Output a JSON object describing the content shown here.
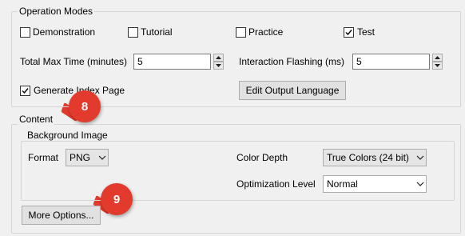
{
  "operation_modes": {
    "title": "Operation Modes",
    "checkboxes": [
      {
        "label": "Demonstration",
        "checked": false
      },
      {
        "label": "Tutorial",
        "checked": false
      },
      {
        "label": "Practice",
        "checked": false
      },
      {
        "label": "Test",
        "checked": true
      }
    ],
    "total_max_time": {
      "label": "Total Max Time (minutes)",
      "value": "5"
    },
    "interaction_flashing": {
      "label": "Interaction Flashing (ms)",
      "value": "5"
    },
    "generate_index": {
      "label": "Generate Index Page",
      "checked": true
    },
    "edit_output_language_label": "Edit Output Language"
  },
  "content": {
    "title": "Content",
    "background_image": {
      "title": "Background Image",
      "format": {
        "label": "Format",
        "value": "PNG"
      },
      "color_depth": {
        "label": "Color Depth",
        "value": "True Colors (24 bit)"
      },
      "optimization_level": {
        "label": "Optimization Level",
        "value": "Normal"
      }
    },
    "more_options_label": "More Options..."
  },
  "callouts": {
    "badge_8": "8",
    "badge_9": "9",
    "color": "#e23a2c"
  }
}
